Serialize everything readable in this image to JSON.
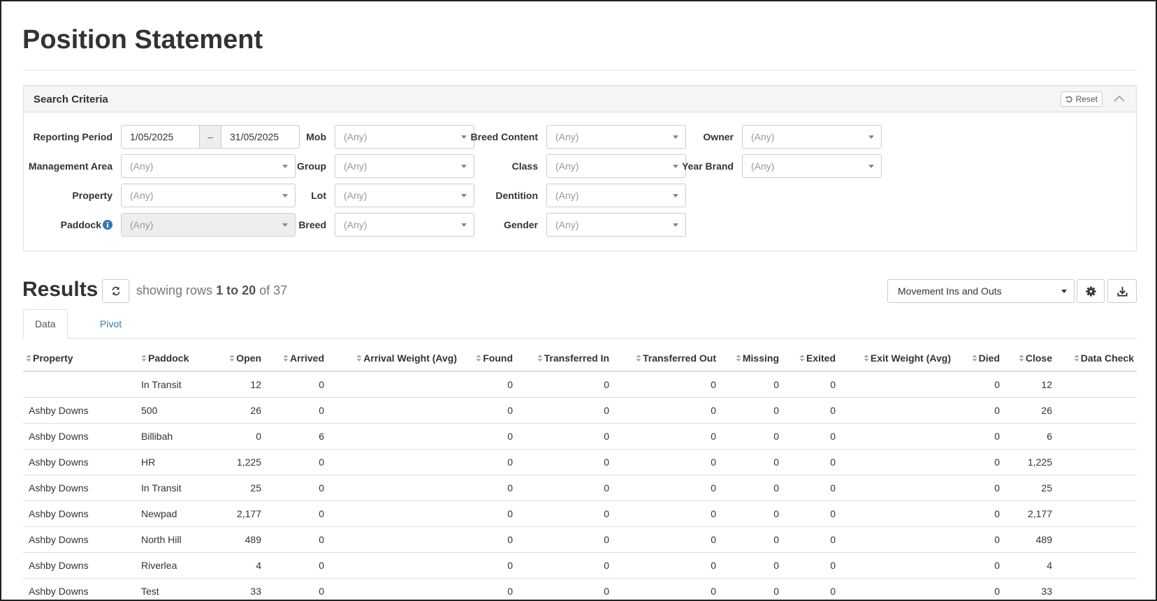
{
  "page": {
    "title": "Position Statement"
  },
  "search": {
    "title": "Search Criteria",
    "reset_label": "Reset",
    "reporting_period": {
      "label": "Reporting Period",
      "from": "1/05/2025",
      "sep": "–",
      "to": "31/05/2025"
    },
    "fields": {
      "management_area": {
        "label": "Management Area",
        "value": "(Any)"
      },
      "property": {
        "label": "Property",
        "value": "(Any)"
      },
      "paddock": {
        "label": "Paddock",
        "value": "(Any)"
      },
      "mob": {
        "label": "Mob",
        "value": "(Any)"
      },
      "group": {
        "label": "Group",
        "value": "(Any)"
      },
      "lot": {
        "label": "Lot",
        "value": "(Any)"
      },
      "breed": {
        "label": "Breed",
        "value": "(Any)"
      },
      "breed_content": {
        "label": "Breed Content",
        "value": "(Any)"
      },
      "class": {
        "label": "Class",
        "value": "(Any)"
      },
      "dentition": {
        "label": "Dentition",
        "value": "(Any)"
      },
      "gender": {
        "label": "Gender",
        "value": "(Any)"
      },
      "owner": {
        "label": "Owner",
        "value": "(Any)"
      },
      "year_brand": {
        "label": "Year Brand",
        "value": "(Any)"
      }
    }
  },
  "results": {
    "title": "Results",
    "rows_prefix": "showing rows",
    "rows_range": "1 to 20",
    "rows_of": "of 37",
    "view": "Movement Ins and Outs",
    "tabs": [
      {
        "label": "Data"
      },
      {
        "label": "Pivot"
      }
    ],
    "columns": [
      "Property",
      "Paddock",
      "Open",
      "Arrived",
      "Arrival Weight (Avg)",
      "Found",
      "Transferred In",
      "Transferred Out",
      "Missing",
      "Exited",
      "Exit Weight (Avg)",
      "Died",
      "Close",
      "Data Check"
    ],
    "rows": [
      [
        "",
        "In Transit",
        "12",
        "0",
        "",
        "0",
        "0",
        "0",
        "0",
        "0",
        "",
        "0",
        "12",
        ""
      ],
      [
        "Ashby Downs",
        "500",
        "26",
        "0",
        "",
        "0",
        "0",
        "0",
        "0",
        "0",
        "",
        "0",
        "26",
        ""
      ],
      [
        "Ashby Downs",
        "Billibah",
        "0",
        "6",
        "",
        "0",
        "0",
        "0",
        "0",
        "0",
        "",
        "0",
        "6",
        ""
      ],
      [
        "Ashby Downs",
        "HR",
        "1,225",
        "0",
        "",
        "0",
        "0",
        "0",
        "0",
        "0",
        "",
        "0",
        "1,225",
        ""
      ],
      [
        "Ashby Downs",
        "In Transit",
        "25",
        "0",
        "",
        "0",
        "0",
        "0",
        "0",
        "0",
        "",
        "0",
        "25",
        ""
      ],
      [
        "Ashby Downs",
        "Newpad",
        "2,177",
        "0",
        "",
        "0",
        "0",
        "0",
        "0",
        "0",
        "",
        "0",
        "2,177",
        ""
      ],
      [
        "Ashby Downs",
        "North Hill",
        "489",
        "0",
        "",
        "0",
        "0",
        "0",
        "0",
        "0",
        "",
        "0",
        "489",
        ""
      ],
      [
        "Ashby Downs",
        "Riverlea",
        "4",
        "0",
        "",
        "0",
        "0",
        "0",
        "0",
        "0",
        "",
        "0",
        "4",
        ""
      ],
      [
        "Ashby Downs",
        "Test",
        "33",
        "0",
        "",
        "0",
        "0",
        "0",
        "0",
        "0",
        "",
        "0",
        "33",
        ""
      ]
    ]
  }
}
